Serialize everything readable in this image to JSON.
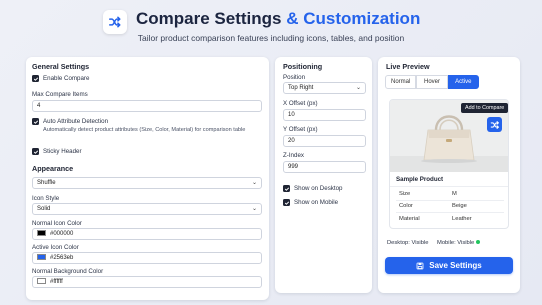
{
  "header": {
    "title_main": "Compare Settings",
    "title_accent": "& Customization",
    "subtitle": "Tailor product comparison features including icons, tables, and position"
  },
  "general": {
    "title": "General Settings",
    "enable_compare": {
      "label": "Enable Compare",
      "checked": true
    },
    "max_items": {
      "label": "Max Compare Items",
      "value": "4"
    },
    "auto_detect": {
      "label": "Auto Attribute Detection",
      "checked": true,
      "description": "Automatically detect product attributes (Size, Color, Material) for comparison table"
    },
    "sticky_header": {
      "label": "Sticky Header",
      "checked": true
    }
  },
  "appearance": {
    "title": "Appearance",
    "icon_select": {
      "value": "Shuffle"
    },
    "icon_style": {
      "label": "Icon Style",
      "value": "Solid"
    },
    "normal_icon_color": {
      "label": "Normal Icon Color",
      "value": "#000000",
      "swatch": "#000000"
    },
    "active_icon_color": {
      "label": "Active Icon Color",
      "value": "#2563eb",
      "swatch": "#2563eb"
    },
    "normal_bg_color": {
      "label": "Normal Background Color",
      "value": "#ffffff",
      "swatch": "#ffffff"
    }
  },
  "positioning": {
    "title": "Positioning",
    "position": {
      "label": "Position",
      "value": "Top Right"
    },
    "x_offset": {
      "label": "X Offset (px)",
      "value": "10"
    },
    "y_offset": {
      "label": "Y Offset (px)",
      "value": "20"
    },
    "z_index": {
      "label": "Z-Index",
      "value": "999"
    },
    "show_desktop": {
      "label": "Show on Desktop",
      "checked": true
    },
    "show_mobile": {
      "label": "Show on Mobile",
      "checked": true
    }
  },
  "preview": {
    "title": "Live Preview",
    "tabs": [
      {
        "label": "Normal",
        "active": false
      },
      {
        "label": "Hover",
        "active": false
      },
      {
        "label": "Active",
        "active": true
      }
    ],
    "tooltip": "Add to Compare",
    "product_title": "Sample Product",
    "attributes": [
      {
        "name": "Size",
        "value": "M"
      },
      {
        "name": "Color",
        "value": "Beige"
      },
      {
        "name": "Material",
        "value": "Leather"
      }
    ],
    "desktop_status": "Desktop: Visible",
    "mobile_status": "Mobile: Visible",
    "save_label": "Save Settings"
  },
  "colors": {
    "accent": "#2563eb",
    "status_ok": "#22c55e"
  },
  "icons": {
    "logo": "shuffle-icon",
    "compare": "shuffle-icon",
    "save": "save-icon"
  }
}
